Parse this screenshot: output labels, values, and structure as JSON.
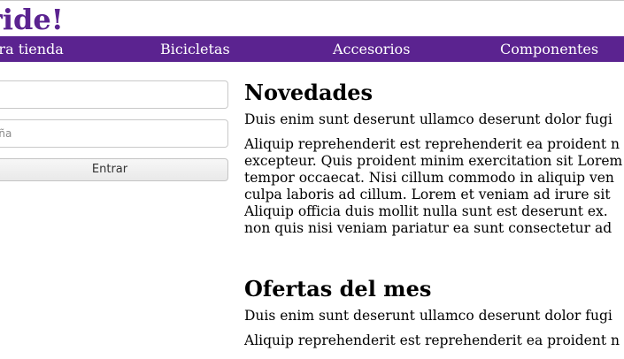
{
  "header": {
    "brand": "ride!"
  },
  "nav": {
    "items": [
      {
        "label": "tra tienda"
      },
      {
        "label": "Bicicletas"
      },
      {
        "label": "Accesorios"
      },
      {
        "label": "Componentes"
      }
    ]
  },
  "login": {
    "user_placeholder": "",
    "password_placeholder": "eña",
    "submit_label": "Entrar"
  },
  "sections": [
    {
      "title": "Novedades",
      "lead": "Duis enim sunt deserunt ullamco deserunt dolor fugi",
      "body": [
        "Aliquip reprehenderit est reprehenderit ea proident n",
        "excepteur. Quis proident minim exercitation sit Lorem",
        "tempor occaecat. Nisi cillum commodo in aliquip ven",
        "culpa laboris ad cillum. Lorem et veniam ad irure sit",
        "Aliquip officia duis mollit nulla sunt est deserunt ex.",
        "non quis nisi veniam pariatur ea sunt consectetur ad"
      ]
    },
    {
      "title": "Ofertas del mes",
      "lead": "Duis enim sunt deserunt ullamco deserunt dolor fugi",
      "body": [
        "Aliquip reprehenderit est reprehenderit ea proident n"
      ]
    }
  ]
}
